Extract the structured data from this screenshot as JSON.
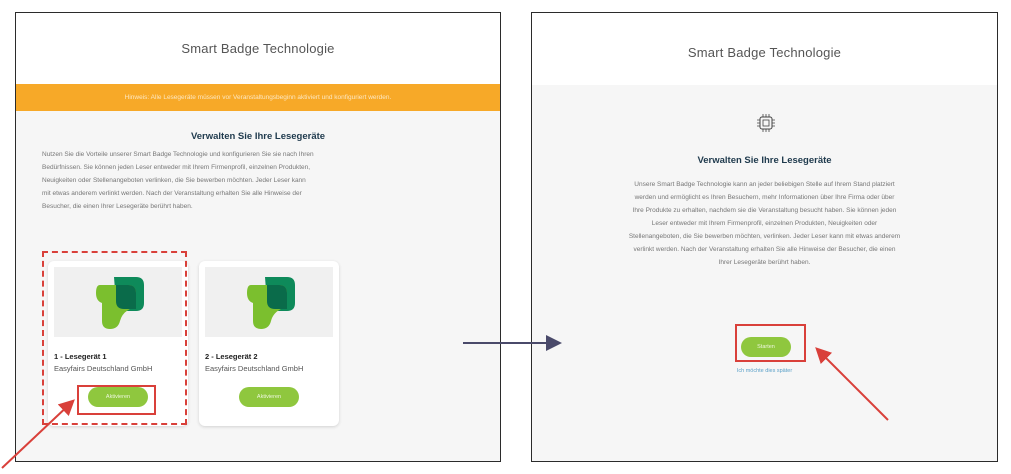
{
  "left": {
    "title": "Smart Badge Technologie",
    "banner": "Hinweis: Alle Lesegeräte müssen vor Veranstaltungsbeginn aktiviert und konfiguriert werden.",
    "heading": "Verwalten Sie Ihre Lesegeräte",
    "paragraph_lines": [
      "Nutzen Sie die Vorteile unserer Smart Badge Technologie und konfigurieren Sie sie nach Ihren",
      "Bedürfnissen. Sie können jeden Leser entweder mit Ihrem Firmenprofil, einzelnen Produkten,",
      "Neuigkeiten oder Stellenangeboten verlinken, die Sie bewerben möchten. Jeder Leser kann",
      "mit etwas anderem verlinkt werden. Nach der Veranstaltung erhalten Sie alle Hinweise der",
      "Besucher, die einen Ihrer Lesegeräte berührt haben."
    ],
    "cards": [
      {
        "name": "1 - Lesegerät 1",
        "org": "Easyfairs Deutschland GmbH",
        "button": "Aktivieren"
      },
      {
        "name": "2 - Lesegerät 2",
        "org": "Easyfairs Deutschland GmbH",
        "button": "Aktivieren"
      }
    ]
  },
  "right": {
    "title": "Smart Badge Technologie",
    "heading": "Verwalten Sie Ihre Lesegeräte",
    "paragraph_lines": [
      "Unsere Smart Badge Technologie kann an jeder beliebigen Stelle auf Ihrem Stand platziert",
      "werden und ermöglicht es Ihren Besuchern, mehr Informationen über Ihre Firma oder über",
      "Ihre Produkte zu erhalten, nachdem sie die Veranstaltung besucht haben. Sie können jeden",
      "Leser entweder mit Ihrem Firmenprofil, einzelnen Produkten, Neuigkeiten oder",
      "Stellenangeboten, die Sie bewerben möchten, verlinken. Jeder Leser kann mit etwas anderem",
      "verlinkt werden. Nach der Veranstaltung erhalten Sie alle Hinweise der Besucher, die einen",
      "Ihrer Lesegeräte berührt haben."
    ],
    "button": "Starten",
    "link": "Ich möchte dies später"
  },
  "colors": {
    "banner": "#f7a928",
    "button": "#8fc73e",
    "highlight": "#d9403a",
    "arrow": "#4a4a6a",
    "heading": "#1f3a4d"
  },
  "icons": [
    "chip-icon",
    "lesegeraet-logo-icon"
  ]
}
